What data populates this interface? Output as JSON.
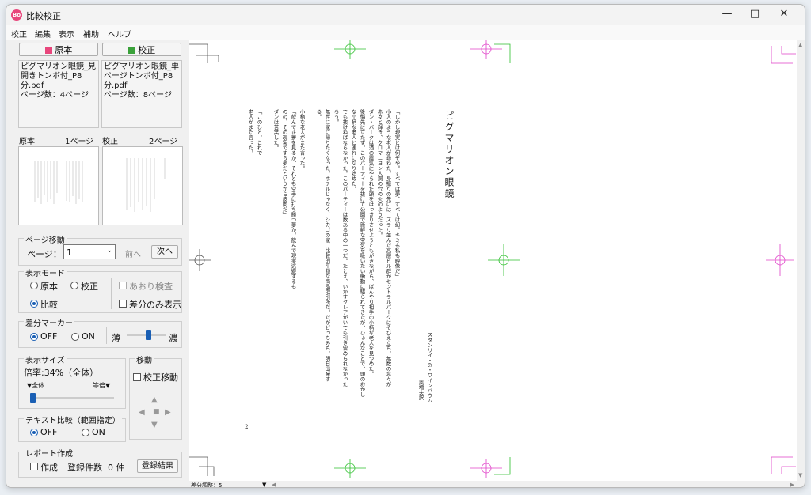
{
  "window": {
    "title": "比較校正",
    "app_icon_text": "Bo"
  },
  "menu": [
    "校正",
    "編集",
    "表示",
    "補助",
    "ヘルプ"
  ],
  "top_buttons": {
    "original": "原本",
    "proof": "校正",
    "original_color": "#e8467c",
    "proof_color": "#3aa13a"
  },
  "files": {
    "original": {
      "name": "ピグマリオン眼鏡_見開きトンボ付_P8分.pdf",
      "pages": "ページ数：4ページ"
    },
    "proof": {
      "name": "ピグマリオン眼鏡_単ページトンボ付_P8分.pdf",
      "pages": "ページ数：8ページ"
    }
  },
  "thumbs": {
    "original_label": "原本",
    "original_page": "1ページ",
    "proof_label": "校正",
    "proof_page": "2ページ"
  },
  "page_nav": {
    "group": "ページ移動",
    "page_label": "ページ：",
    "page_value": "1",
    "prev": "前へ",
    "next": "次へ"
  },
  "display_mode": {
    "group": "表示モード",
    "original": "原本",
    "proof": "校正",
    "flip": "あおり検査",
    "compare": "比較",
    "diff_only": "差分のみ表示"
  },
  "diff_marker": {
    "group": "差分マーカー",
    "off": "OFF",
    "on": "ON",
    "light": "薄",
    "dark": "濃",
    "level": 0.55
  },
  "display_size": {
    "group": "表示サイズ",
    "zoom": "倍率:34%（全体）",
    "whole": "▼全体",
    "actual": "等倍▼",
    "level": 0.0
  },
  "move": {
    "group": "移動",
    "proof_move": "校正移動"
  },
  "text_compare": {
    "group": "テキスト比較（範囲指定）",
    "off": "OFF",
    "on": "ON"
  },
  "report": {
    "group": "レポート作成",
    "create": "作成",
    "count_label": "登録件数",
    "count": "0 件",
    "result": "登録結果"
  },
  "statusbar": {
    "diff_adjust": "差分調整：5"
  },
  "document": {
    "title": "ピグマリオン眼鏡",
    "author": "スタンリイ・G・ワインバウム",
    "translator": "奥増夫訳",
    "page_number": "2",
    "body": [
      "「しかし現実とは何ぞや。すべては夢、すべては幻。キミも私も映像だ」",
      "小人のような老人が尋ねた。身振りの先には、ズラリ並んだ高層ビル群がセントラルパークにそびえ立ち、無数の窓々が",
      "赤々と輝き、クロマニヨン人洞の穴の火のようだった。",
      "ダン・バークは酒の霞気にやられた頭をはっきりさせようともがきながら、ぼんやり相手の小柄な老人を見つめた。",
      "後悔先に立たず。このパーティーを抜けて公園で新鮮な空気を吸いたい衝動に駆られてきたが、ひょんなことで、頭のおかし",
      "な小柄な老人と連れになり始めた。",
      "でも抜けねばならなかった。このパーティーは数ある中の一つだ。たとえ、いかすクレアがいても引き留められなかった",
      "ろう。",
      "無性に家に帰りたくなった。ホテルじゃなく、シカゴの家、比較的平穏な商品取引所だ。だがどっちみち、明日出発す",
      "る。",
      "小柄な老人がまた言った。",
      "「飲んで正夢を見るか、それとも空手に打ち勝つ夢か。飲んで現実逃避するも",
      "のの、その現実ですら夢だというから皮肉だ」",
      "ダンは苦笑した。",
      "「このひと、これで",
      "老人がまた言った。"
    ]
  }
}
